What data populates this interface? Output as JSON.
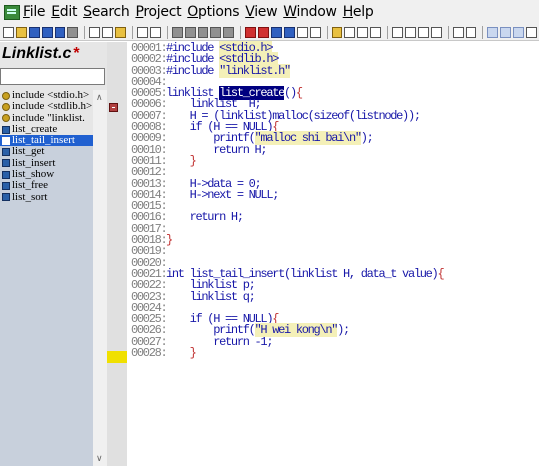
{
  "menu": [
    "File",
    "Edit",
    "Search",
    "Project",
    "Options",
    "View",
    "Window",
    "Help"
  ],
  "left": {
    "file_name": "Linklist.c",
    "modified_mark": "*",
    "symbols": [
      {
        "kind": "inc",
        "label": "include <stdio.h>"
      },
      {
        "kind": "inc",
        "label": "include <stdlib.h>"
      },
      {
        "kind": "inc",
        "label": "include \"linklist."
      },
      {
        "kind": "fn",
        "label": "list_create"
      },
      {
        "kind": "fn",
        "label": "list_tail_insert",
        "selected": true
      },
      {
        "kind": "fn",
        "label": "list_get"
      },
      {
        "kind": "fn",
        "label": "list_insert"
      },
      {
        "kind": "fn",
        "label": "list_show"
      },
      {
        "kind": "fn",
        "label": "list_free"
      },
      {
        "kind": "fn",
        "label": "list_sort"
      }
    ]
  },
  "code": [
    {
      "n": "00001:",
      "t": "#include <stdio.h>"
    },
    {
      "n": "00002:",
      "t": "#include <stdlib.h>"
    },
    {
      "n": "00003:",
      "t": "#include \"linklist.h\""
    },
    {
      "n": "00004:",
      "t": ""
    },
    {
      "n": "00005:",
      "t": "linklist list_create(){"
    },
    {
      "n": "00006:",
      "t": "    linklist  H;"
    },
    {
      "n": "00007:",
      "t": "    H = (linklist)malloc(sizeof(listnode));"
    },
    {
      "n": "00008:",
      "t": "    if (H == NULL){"
    },
    {
      "n": "00009:",
      "t": "        printf(\"malloc shi bai\\n\");"
    },
    {
      "n": "00010:",
      "t": "        return H;"
    },
    {
      "n": "00011:",
      "t": "    }"
    },
    {
      "n": "00012:",
      "t": ""
    },
    {
      "n": "00013:",
      "t": "    H->data = 0;"
    },
    {
      "n": "00014:",
      "t": "    H->next = NULL;"
    },
    {
      "n": "00015:",
      "t": ""
    },
    {
      "n": "00016:",
      "t": "    return H;"
    },
    {
      "n": "00017:",
      "t": ""
    },
    {
      "n": "00018:",
      "t": "}"
    },
    {
      "n": "00019:",
      "t": ""
    },
    {
      "n": "00020:",
      "t": ""
    },
    {
      "n": "00021:",
      "t": "int list_tail_insert(linklist H, data_t value){"
    },
    {
      "n": "00022:",
      "t": "    linklist p;"
    },
    {
      "n": "00023:",
      "t": "    linklist q;"
    },
    {
      "n": "00024:",
      "t": ""
    },
    {
      "n": "00025:",
      "t": "    if (H == NULL){"
    },
    {
      "n": "00026:",
      "t": "        printf(\"H wei kong\\n\");"
    },
    {
      "n": "00027:",
      "t": "        return -1;"
    },
    {
      "n": "00028:",
      "t": "    }"
    }
  ]
}
